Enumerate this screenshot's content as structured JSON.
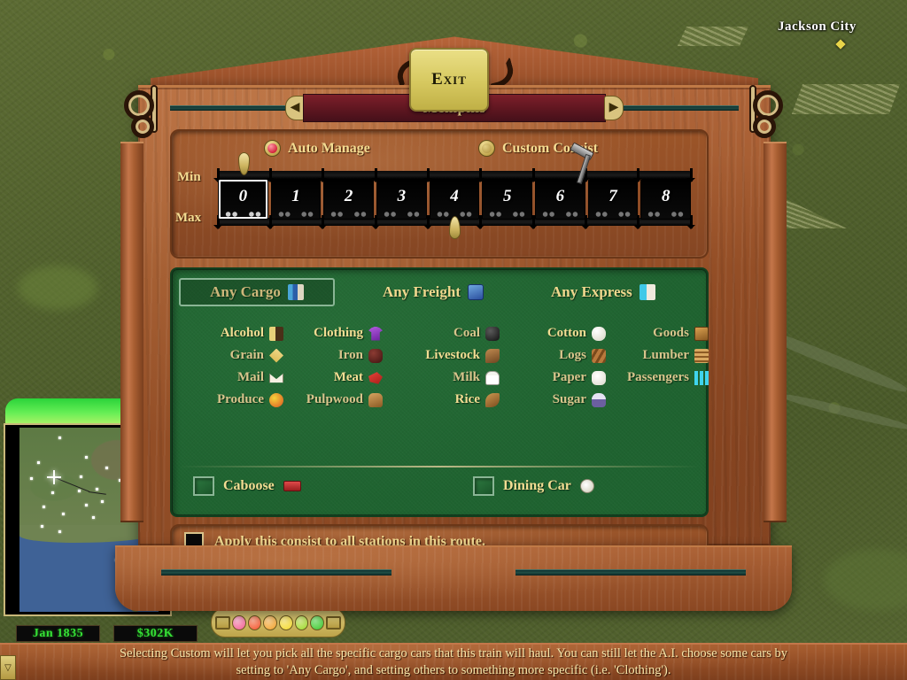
{
  "map": {
    "city_label": "Jackson City",
    "city_marker": "city-marker-icon"
  },
  "hud": {
    "date": "Jan 1835",
    "cash": "$302K",
    "toolbar_buttons": [
      "city-view-icon",
      "graph-icon",
      "train-icon"
    ],
    "jewel_colors": [
      "#f05a8e",
      "#f0502a",
      "#f0a02a",
      "#f0d62a",
      "#9ad62a",
      "#3cc22a"
    ],
    "folder_icon": "folder-icon",
    "book_icon": "book-icon"
  },
  "dialog": {
    "title": "Memphis",
    "prev_arrow": "◀",
    "next_arrow": "▶",
    "consist": {
      "auto_manage_label": "Auto Manage",
      "custom_consist_label": "Custom Consist",
      "selected_mode": "Auto Manage",
      "min_label": "Min",
      "max_label": "Max",
      "car_numbers": [
        "0",
        "1",
        "2",
        "3",
        "4",
        "5",
        "6",
        "7",
        "8"
      ],
      "min_value": 0,
      "max_value": 4,
      "selected_car": "0"
    },
    "cargo": {
      "any_buttons": [
        {
          "label": "Any Cargo",
          "icon": "any-cargo-icon",
          "selected": true
        },
        {
          "label": "Any Freight",
          "icon": "freight-crate-icon",
          "selected": false
        },
        {
          "label": "Any Express",
          "icon": "express-mail-icon",
          "selected": false
        }
      ],
      "columns": [
        {
          "items": [
            {
              "label": "Alcohol",
              "icon": "alcohol-icon",
              "bright": true
            },
            {
              "label": "Grain",
              "icon": "grain-icon",
              "bright": false
            },
            {
              "label": "Mail",
              "icon": "mail-icon",
              "bright": false
            },
            {
              "label": "Produce",
              "icon": "produce-icon",
              "bright": false
            }
          ]
        },
        {
          "items": [
            {
              "label": "Clothing",
              "icon": "clothing-icon",
              "bright": true
            },
            {
              "label": "Iron",
              "icon": "iron-icon",
              "bright": false
            },
            {
              "label": "Meat",
              "icon": "meat-icon",
              "bright": true
            },
            {
              "label": "Pulpwood",
              "icon": "pulpwood-icon",
              "bright": false
            }
          ]
        },
        {
          "items": [
            {
              "label": "Coal",
              "icon": "coal-icon",
              "bright": false
            },
            {
              "label": "Livestock",
              "icon": "livestock-icon",
              "bright": true
            },
            {
              "label": "Milk",
              "icon": "milk-icon",
              "bright": false
            },
            {
              "label": "Rice",
              "icon": "rice-icon",
              "bright": true
            }
          ]
        },
        {
          "items": [
            {
              "label": "Cotton",
              "icon": "cotton-icon",
              "bright": true
            },
            {
              "label": "Logs",
              "icon": "logs-icon",
              "bright": false
            },
            {
              "label": "Paper",
              "icon": "paper-icon",
              "bright": false
            },
            {
              "label": "Sugar",
              "icon": "sugar-icon",
              "bright": false
            }
          ]
        },
        {
          "items": [
            {
              "label": "Goods",
              "icon": "goods-icon",
              "bright": false
            },
            {
              "label": "Lumber",
              "icon": "lumber-icon",
              "bright": false
            },
            {
              "label": "Passengers",
              "icon": "passengers-icon",
              "bright": false
            }
          ]
        }
      ],
      "extra_cars": [
        {
          "label": "Caboose",
          "icon": "caboose-icon",
          "checked": false
        },
        {
          "label": "Dining Car",
          "icon": "dining-car-icon",
          "checked": false
        }
      ]
    },
    "apply": {
      "label": "Apply this consist to all stations in this route.",
      "checked": false
    },
    "exit_label": "Exit"
  },
  "tooltip": {
    "line1": "Selecting Custom will let you pick all the specific cargo cars that this train will haul.  You can still let the A.I. choose some cars by",
    "line2": "setting to 'Any Cargo', and setting others to something more specific (i.e. 'Clothing')."
  },
  "colors": {
    "wood": "#96512a",
    "green_panel": "#1f6330",
    "gold_text": "#f4dc92",
    "title_plate": "#5e1620",
    "hud_green": "#35e035"
  }
}
